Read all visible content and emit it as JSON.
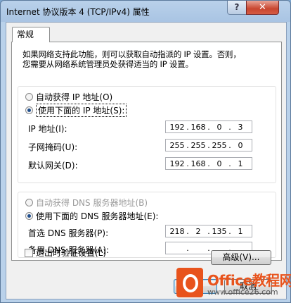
{
  "window": {
    "title": "Internet 协议版本 4 (TCP/IPv4) 属性",
    "help_label": "?",
    "close_label": "✕"
  },
  "tabs": [
    {
      "label": "常规"
    }
  ],
  "intro": {
    "line1": "如果网络支持此功能，则可以获取自动指派的 IP 设置。否则，",
    "line2": "您需要从网络系统管理员处获得适当的 IP 设置。"
  },
  "ip_section": {
    "auto_label": "自动获得 IP 地址(O)",
    "manual_label": "使用下面的 IP 地址(S):",
    "selected": "manual",
    "fields": [
      {
        "label": "IP 地址(I):",
        "octets": [
          "192",
          "168",
          "0",
          "3"
        ]
      },
      {
        "label": "子网掩码(U):",
        "octets": [
          "255",
          "255",
          "255",
          "0"
        ]
      },
      {
        "label": "默认网关(D):",
        "octets": [
          "192",
          "168",
          "0",
          "1"
        ]
      }
    ]
  },
  "dns_section": {
    "auto_label": "自动获得 DNS 服务器地址(B)",
    "manual_label": "使用下面的 DNS 服务器地址(E):",
    "selected": "manual",
    "fields": [
      {
        "label": "首选 DNS 服务器(P):",
        "octets": [
          "218",
          "2",
          "135",
          "1"
        ]
      },
      {
        "label": "备用 DNS 服务器(A):",
        "octets": [
          "",
          "",
          "",
          ""
        ]
      }
    ]
  },
  "validate_label": "退出时验证设置(L)",
  "advanced_label": "高级(V)...",
  "cancel_label": "取消",
  "watermark": {
    "text": "Office教程网",
    "url": "www.office26.com"
  }
}
